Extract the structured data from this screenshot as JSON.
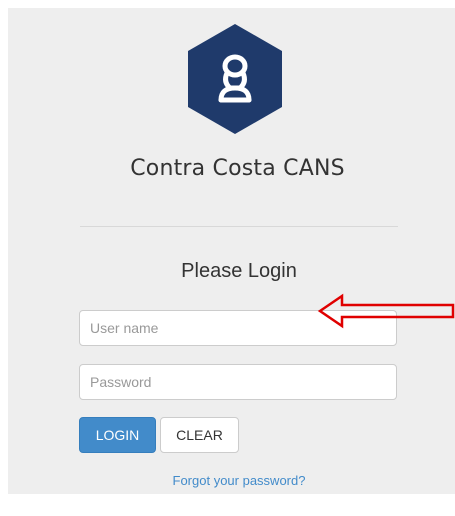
{
  "app": {
    "title": "Contra Costa CANS"
  },
  "login": {
    "heading": "Please Login",
    "username_placeholder": "User name",
    "password_placeholder": "Password",
    "login_label": "LOGIN",
    "clear_label": "CLEAR",
    "forgot_label": "Forgot your password?"
  },
  "colors": {
    "logo_bg": "#1f3a6b",
    "primary": "#428bca",
    "panel": "#eeeeee",
    "annotation_arrow": "#e00000"
  },
  "icons": {
    "logo": "hexagon-hourglass-logo",
    "annotation": "left-arrow-annotation"
  }
}
